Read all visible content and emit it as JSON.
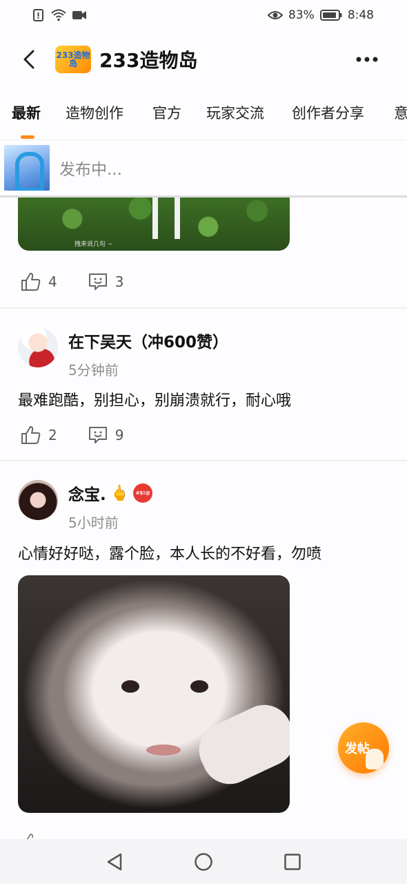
{
  "status_bar": {
    "battery": "83%",
    "time": "8:48"
  },
  "header": {
    "logo_text": "233造物岛",
    "title": "233造物岛"
  },
  "tabs": [
    {
      "label": "最新",
      "active": true
    },
    {
      "label": "造物创作",
      "active": false
    },
    {
      "label": "官方",
      "active": false
    },
    {
      "label": "玩家交流",
      "active": false
    },
    {
      "label": "创作者分享",
      "active": false
    },
    {
      "label": "意",
      "active": false
    }
  ],
  "publishing": {
    "text": "发布中..."
  },
  "posts": [
    {
      "image_caption": "拽来说几句 ~",
      "likes": "4",
      "comments": "3"
    },
    {
      "author": "在下吴天（冲600赞）",
      "time": "5分钟前",
      "text": "最难跑酷，别担心，别崩溃就行，耐心哦",
      "likes": "2",
      "comments": "9"
    },
    {
      "author": "念宝.",
      "author_emoji": "🖕",
      "angry_badge": "#$!@",
      "time": "5小时前",
      "text": "心情好好哒，露个脸，本人长的不好看，勿喷"
    }
  ],
  "fab": {
    "label": "发帖"
  },
  "colors": {
    "accent": "#ff8a1c",
    "text_secondary": "#8f8f8f"
  }
}
